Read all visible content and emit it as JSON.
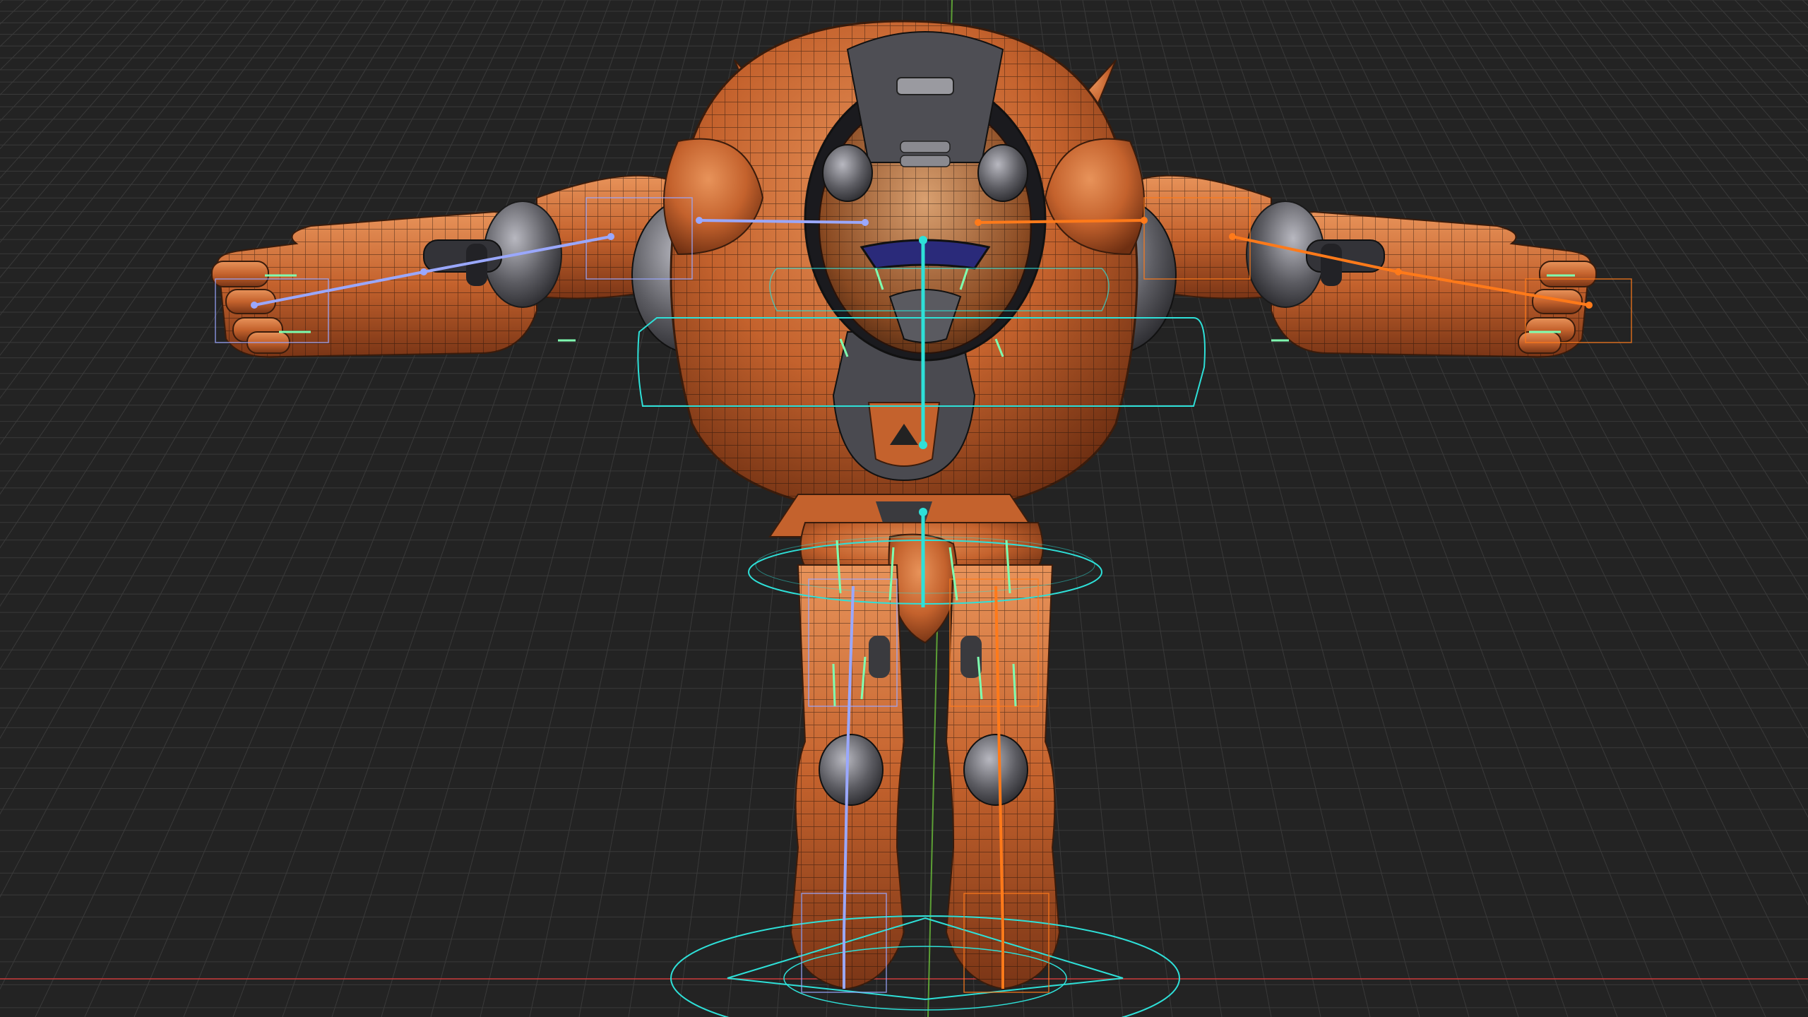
{
  "viewport": {
    "background": "#232323",
    "grid_color": "#3a3a3a",
    "x_axis_color": "#c23a3a",
    "y_axis_color": "#6bbf3a"
  },
  "model": {
    "body_color": "#c4622d",
    "body_highlight": "#e08a4e",
    "body_shadow": "#7a3516",
    "joint_color": "#6e6e74",
    "visor_color": "#2a2a6e",
    "wire_color": "#1a0d08"
  },
  "rig": {
    "center_color": "#2ee0d8",
    "left_color": "#9aa8ff",
    "right_color": "#ff7a1a",
    "control_color": "#3ad6c6",
    "finger_color": "#7fffb0"
  },
  "icons": [
    "robot-model-icon",
    "armature-icon",
    "root-control-icon"
  ]
}
